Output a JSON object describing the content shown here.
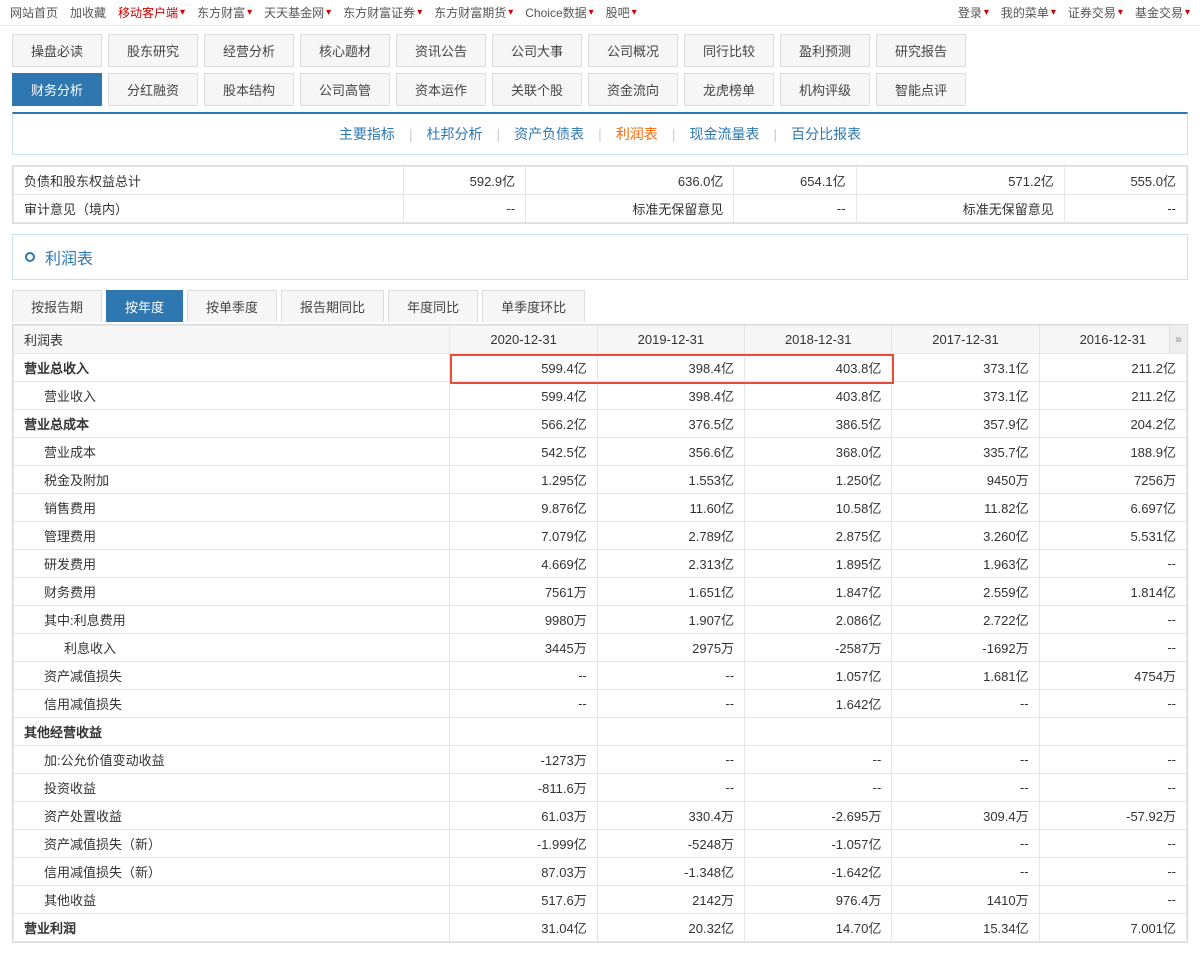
{
  "topnav_left": [
    {
      "label": "网站首页",
      "red": false,
      "chev": false
    },
    {
      "label": "加收藏",
      "red": false,
      "chev": false
    },
    {
      "label": "移动客户端",
      "red": true,
      "chev": true
    },
    {
      "label": "东方财富",
      "red": false,
      "chev": true
    },
    {
      "label": "天天基金网",
      "red": false,
      "chev": true
    },
    {
      "label": "东方财富证券",
      "red": false,
      "chev": true
    },
    {
      "label": "东方财富期货",
      "red": false,
      "chev": true
    },
    {
      "label": "Choice数据",
      "red": false,
      "chev": true
    },
    {
      "label": "股吧",
      "red": false,
      "chev": true
    }
  ],
  "topnav_right": [
    {
      "label": "登录",
      "chev": true
    },
    {
      "label": "我的菜单",
      "chev": true
    },
    {
      "label": "证券交易",
      "chev": true
    },
    {
      "label": "基金交易",
      "chev": true
    }
  ],
  "modules_row1": [
    "操盘必读",
    "股东研究",
    "经营分析",
    "核心题材",
    "资讯公告",
    "公司大事",
    "公司概况",
    "同行比较",
    "盈利预测",
    "研究报告"
  ],
  "modules_row2": [
    "财务分析",
    "分红融资",
    "股本结构",
    "公司高管",
    "资本运作",
    "关联个股",
    "资金流向",
    "龙虎榜单",
    "机构评级",
    "智能点评"
  ],
  "modules_row2_active": 0,
  "subtabs": [
    "主要指标",
    "杜邦分析",
    "资产负债表",
    "利润表",
    "现金流量表",
    "百分比报表"
  ],
  "subtabs_active": 3,
  "pretable": {
    "rows": [
      {
        "label": "负债和股东权益总计",
        "vals": [
          "592.9亿",
          "636.0亿",
          "654.1亿",
          "571.2亿",
          "555.0亿"
        ]
      },
      {
        "label": "审计意见（境内）",
        "vals": [
          "--",
          "标准无保留意见",
          "--",
          "标准无保留意见",
          "--"
        ]
      }
    ]
  },
  "section_title": "利润表",
  "period_tabs": [
    "按报告期",
    "按年度",
    "按单季度",
    "报告期同比",
    "年度同比",
    "单季度环比"
  ],
  "period_active": 1,
  "table": {
    "header_label": "利润表",
    "dates": [
      "2020-12-31",
      "2019-12-31",
      "2018-12-31",
      "2017-12-31",
      "2016-12-31"
    ],
    "rows": [
      {
        "label": "营业总收入",
        "indent": 0,
        "bold": true,
        "vals": [
          "599.4亿",
          "398.4亿",
          "403.8亿",
          "373.1亿",
          "211.2亿"
        ]
      },
      {
        "label": "营业收入",
        "indent": 1,
        "bold": false,
        "vals": [
          "599.4亿",
          "398.4亿",
          "403.8亿",
          "373.1亿",
          "211.2亿"
        ]
      },
      {
        "label": "营业总成本",
        "indent": 0,
        "bold": true,
        "vals": [
          "566.2亿",
          "376.5亿",
          "386.5亿",
          "357.9亿",
          "204.2亿"
        ]
      },
      {
        "label": "营业成本",
        "indent": 1,
        "bold": false,
        "vals": [
          "542.5亿",
          "356.6亿",
          "368.0亿",
          "335.7亿",
          "188.9亿"
        ]
      },
      {
        "label": "税金及附加",
        "indent": 1,
        "bold": false,
        "vals": [
          "1.295亿",
          "1.553亿",
          "1.250亿",
          "9450万",
          "7256万"
        ]
      },
      {
        "label": "销售费用",
        "indent": 1,
        "bold": false,
        "vals": [
          "9.876亿",
          "11.60亿",
          "10.58亿",
          "11.82亿",
          "6.697亿"
        ]
      },
      {
        "label": "管理费用",
        "indent": 1,
        "bold": false,
        "vals": [
          "7.079亿",
          "2.789亿",
          "2.875亿",
          "3.260亿",
          "5.531亿"
        ]
      },
      {
        "label": "研发费用",
        "indent": 1,
        "bold": false,
        "vals": [
          "4.669亿",
          "2.313亿",
          "1.895亿",
          "1.963亿",
          "--"
        ]
      },
      {
        "label": "财务费用",
        "indent": 1,
        "bold": false,
        "vals": [
          "7561万",
          "1.651亿",
          "1.847亿",
          "2.559亿",
          "1.814亿"
        ]
      },
      {
        "label": "其中:利息费用",
        "indent": 1,
        "bold": false,
        "vals": [
          "9980万",
          "1.907亿",
          "2.086亿",
          "2.722亿",
          "--"
        ]
      },
      {
        "label": "利息收入",
        "indent": 2,
        "bold": false,
        "vals": [
          "3445万",
          "2975万",
          "-2587万",
          "-1692万",
          "--"
        ]
      },
      {
        "label": "资产减值损失",
        "indent": 1,
        "bold": false,
        "vals": [
          "--",
          "--",
          "1.057亿",
          "1.681亿",
          "4754万"
        ]
      },
      {
        "label": "信用减值损失",
        "indent": 1,
        "bold": false,
        "vals": [
          "--",
          "--",
          "1.642亿",
          "--",
          "--"
        ]
      },
      {
        "label": "其他经营收益",
        "indent": 0,
        "bold": true,
        "vals": [
          "",
          "",
          "",
          "",
          ""
        ]
      },
      {
        "label": "加:公允价值变动收益",
        "indent": 1,
        "bold": false,
        "vals": [
          "-1273万",
          "--",
          "--",
          "--",
          "--"
        ]
      },
      {
        "label": "投资收益",
        "indent": 1,
        "bold": false,
        "vals": [
          "-811.6万",
          "--",
          "--",
          "--",
          "--"
        ]
      },
      {
        "label": "资产处置收益",
        "indent": 1,
        "bold": false,
        "vals": [
          "61.03万",
          "330.4万",
          "-2.695万",
          "309.4万",
          "-57.92万"
        ]
      },
      {
        "label": "资产减值损失（新）",
        "indent": 1,
        "bold": false,
        "vals": [
          "-1.999亿",
          "-5248万",
          "-1.057亿",
          "--",
          "--"
        ]
      },
      {
        "label": "信用减值损失（新）",
        "indent": 1,
        "bold": false,
        "vals": [
          "87.03万",
          "-1.348亿",
          "-1.642亿",
          "--",
          "--"
        ]
      },
      {
        "label": "其他收益",
        "indent": 1,
        "bold": false,
        "vals": [
          "517.6万",
          "2142万",
          "976.4万",
          "1410万",
          "--"
        ]
      },
      {
        "label": "营业利润",
        "indent": 0,
        "bold": true,
        "vals": [
          "31.04亿",
          "20.32亿",
          "14.70亿",
          "15.34亿",
          "7.001亿"
        ]
      }
    ]
  },
  "scroll_arrow": "»"
}
